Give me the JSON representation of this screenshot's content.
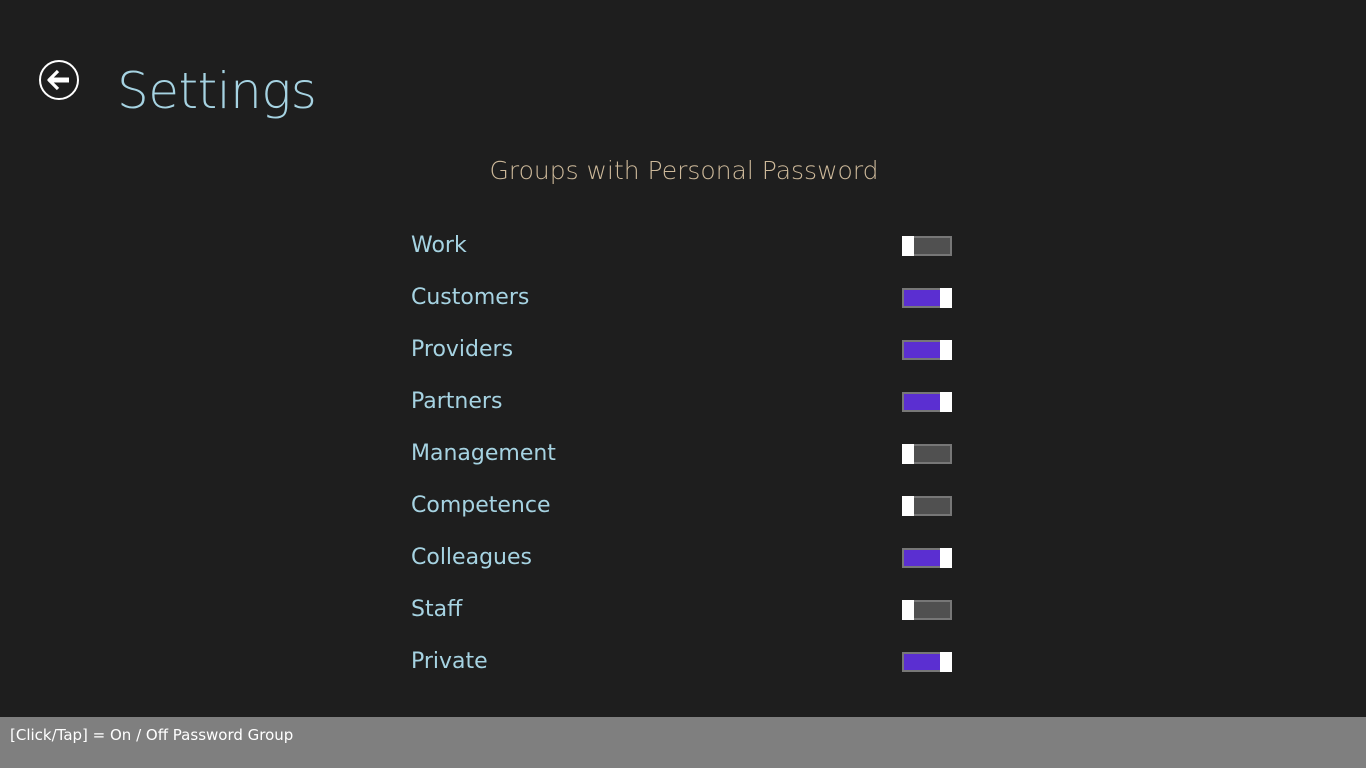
{
  "header": {
    "back_icon": "back-arrow-icon",
    "title": "Settings"
  },
  "section": {
    "title": "Groups with Personal Password"
  },
  "groups": [
    {
      "label": "Work",
      "on": false
    },
    {
      "label": "Customers",
      "on": true
    },
    {
      "label": "Providers",
      "on": true
    },
    {
      "label": "Partners",
      "on": true
    },
    {
      "label": "Management",
      "on": false
    },
    {
      "label": "Competence",
      "on": false
    },
    {
      "label": "Colleagues",
      "on": true
    },
    {
      "label": "Staff",
      "on": false
    },
    {
      "label": "Private",
      "on": true
    }
  ],
  "app_bar": {
    "hint": "[Click/Tap] = On / Off Password Group"
  },
  "colors": {
    "background": "#1e1e1e",
    "title": "#a6d3e2",
    "section_title": "#cdb99a",
    "toggle_on": "#5b2fd1",
    "toggle_off": "#505050",
    "app_bar": "#7f7f7f"
  }
}
